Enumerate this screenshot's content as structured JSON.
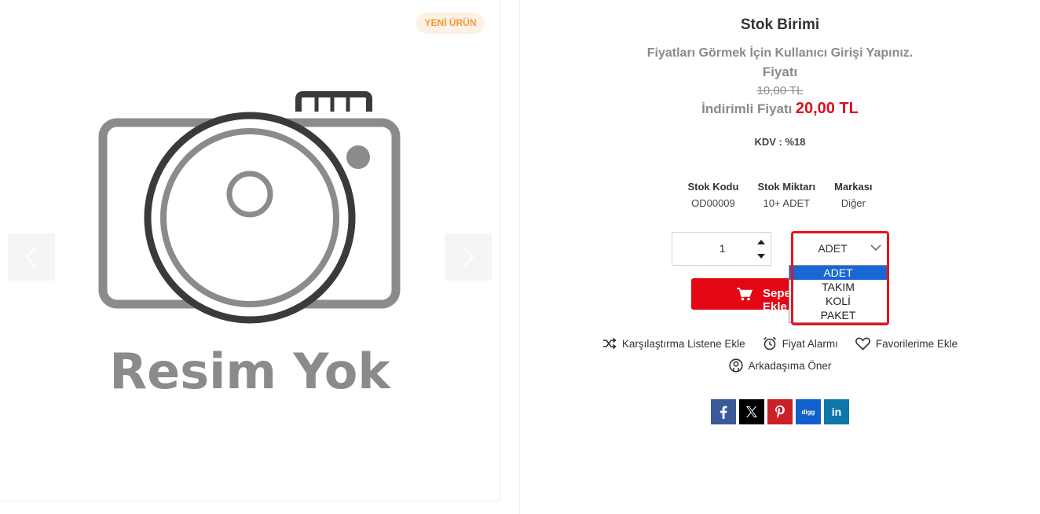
{
  "gallery": {
    "badge": "YENİ ÜRÜN",
    "image_caption": "Resim Yok",
    "prev_icon": "chevron-left-icon",
    "next_icon": "chevron-right-icon"
  },
  "product": {
    "title": "Stok Birimi",
    "login_note": "Fiyatları Görmek İçin Kullanıcı Girişi Yapınız.",
    "price_label": "Fiyatı",
    "old_price": "10,00 TL",
    "discount_label": "İndirimli Fiyatı",
    "discount_price": "20,00 TL",
    "kdv": "KDV : %18"
  },
  "specs": [
    {
      "label": "Stok Kodu",
      "value": "OD00009"
    },
    {
      "label": "Stok Miktarı",
      "value": "10+ ADET"
    },
    {
      "label": "Markası",
      "value": "Diğer"
    }
  ],
  "quantity": {
    "value": "1"
  },
  "unit": {
    "selected": "ADET",
    "options": [
      "ADET",
      "TAKIM",
      "KOLİ",
      "PAKET"
    ]
  },
  "cart": {
    "label": "Sepete Ekle"
  },
  "actions": {
    "compare": "Karşılaştırma Listene Ekle",
    "price_alarm": "Fiyat Alarmı",
    "favorites": "Favorilerime Ekle",
    "recommend": "Arkadaşıma Öner"
  },
  "social": {
    "digg_label": "digg",
    "linkedin_label": "in"
  },
  "colors": {
    "accent_red": "#e30613",
    "price_red": "#d9101d",
    "badge_orange": "#f39a3c",
    "select_blue": "#1967d2"
  }
}
